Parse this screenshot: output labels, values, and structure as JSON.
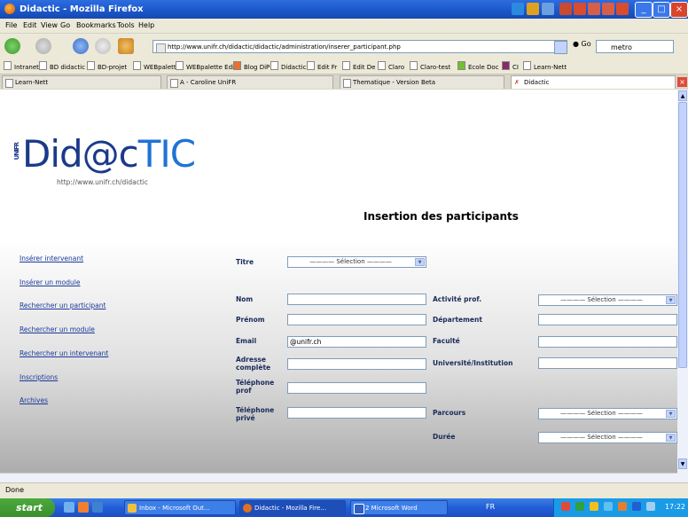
{
  "window": {
    "title": "Didactic - Mozilla Firefox",
    "minimize": "_",
    "maximize": "□",
    "close": "×"
  },
  "menu": [
    "File",
    "Edit",
    "View",
    "Go",
    "Bookmarks",
    "Tools",
    "Help"
  ],
  "nav": {
    "url": "http://www.unifr.ch/didactic/didactic/administration/inserer_participant.php",
    "go_label": "Go",
    "search_value": "metro"
  },
  "bookmarks": [
    "Intranet",
    "BD didactic",
    "BD-projet",
    "WEBpalette",
    "WEBpalette Edit",
    "Blog DiP",
    "Didactic",
    "Edit Fr",
    "Edit De",
    "Claro",
    "Claro-test",
    "Ecole Doc",
    "CI",
    "Learn-Nett"
  ],
  "tabs": [
    {
      "label": "Learn-Nett",
      "active": false
    },
    {
      "label": "A - Caroline UniFR",
      "active": false
    },
    {
      "label": "Thematique - Version Beta",
      "active": false
    },
    {
      "label": "Didactic",
      "active": true
    }
  ],
  "logo": {
    "prefix": "UNIFR",
    "main": "Did@c",
    "accent": "TIC",
    "url": "http://www.unifr.ch/didactic"
  },
  "page_title": "Insertion des participants",
  "sidebar": [
    "Insérer intervenant",
    "Insérer un module",
    "Rechercher un participant",
    "Rechercher un module",
    "Rechercher un intervenant",
    "Inscriptions",
    "Archives"
  ],
  "form": {
    "titre_label": "Titre",
    "select_placeholder": "———— Sélection ————",
    "nom_label": "Nom",
    "prenom_label": "Prénom",
    "email_label": "Email",
    "email_value": "@unifr.ch",
    "adresse_label": "Adresse complète",
    "tel_prof_label": "Téléphone prof",
    "tel_prive_label": "Téléphone privé",
    "activite_label": "Activité prof.",
    "departement_label": "Département",
    "faculte_label": "Faculté",
    "universite_label": "Université/Institution",
    "parcours_label": "Parcours",
    "duree_label": "Durée"
  },
  "status": "Done",
  "taskbar": {
    "start": "start",
    "tasks": [
      "Inbox - Microsoft Out...",
      "Didactic - Mozilla Fire...",
      "2 Microsoft Word",
      "FR"
    ],
    "clock": "17:22"
  },
  "colors": {
    "xp_blue": "#225ed6",
    "link": "#1a3a9a",
    "logo_dark": "#1a3a8a",
    "logo_accent": "#1f73d6"
  }
}
